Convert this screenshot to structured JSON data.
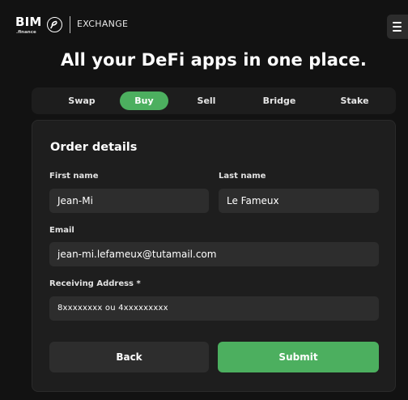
{
  "header": {
    "logo_text": "BIM",
    "logo_sub": ".finance",
    "exchange_label": "EXCHANGE",
    "menu_icon": "hamburger-menu-icon"
  },
  "headline": "All your DeFi apps in one place.",
  "tabs": [
    {
      "label": "Swap",
      "active": false
    },
    {
      "label": "Buy",
      "active": true
    },
    {
      "label": "Sell",
      "active": false
    },
    {
      "label": "Bridge",
      "active": false
    },
    {
      "label": "Stake",
      "active": false
    }
  ],
  "form": {
    "title": "Order details",
    "first_name": {
      "label": "First name",
      "value": "Jean-Mi"
    },
    "last_name": {
      "label": "Last name",
      "value": "Le Fameux"
    },
    "email": {
      "label": "Email",
      "value": "jean-mi.lefameux@tutamail.com"
    },
    "address": {
      "label": "Receiving Address *",
      "value": "8xxxxxxxx  ou  4xxxxxxxxx"
    },
    "back_label": "Back",
    "submit_label": "Submit"
  },
  "colors": {
    "accent": "#4caf5f",
    "background": "#121212",
    "card": "#1e1e1e",
    "field": "#2d2d2d"
  }
}
